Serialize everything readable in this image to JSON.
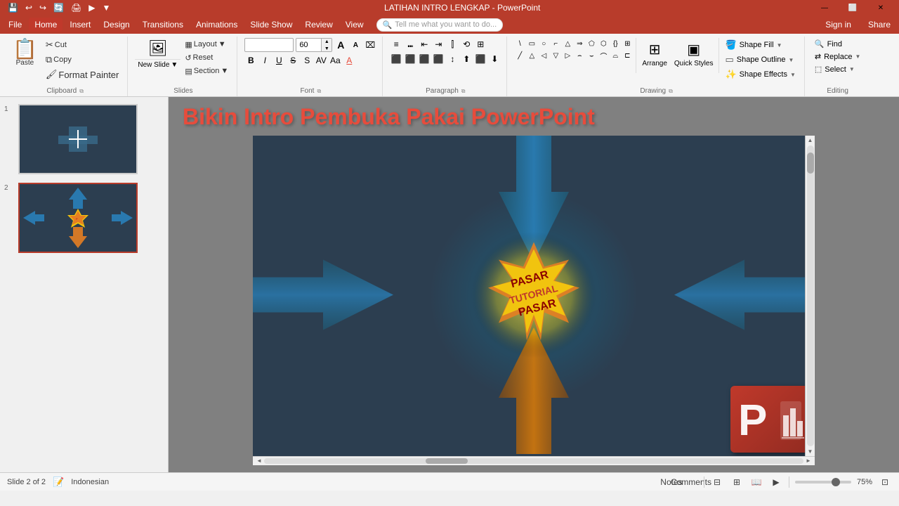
{
  "titlebar": {
    "title": "LATIHAN INTRO LENGKAP - PowerPoint",
    "save_icon": "💾",
    "undo_icon": "↩",
    "redo_icon": "↪",
    "autosave_icon": "🔄",
    "print_icon": "🖨",
    "present_icon": "▶",
    "customize_icon": "▼"
  },
  "menubar": {
    "items": [
      "File",
      "Home",
      "Insert",
      "Design",
      "Transitions",
      "Animations",
      "Slide Show",
      "Review",
      "View"
    ]
  },
  "ribbon": {
    "clipboard": {
      "label": "Clipboard",
      "paste_label": "Paste",
      "cut_label": "Cut",
      "copy_label": "Copy",
      "format_painter_label": "Format Painter"
    },
    "slides": {
      "label": "Slides",
      "new_slide_label": "New Slide",
      "layout_label": "Layout",
      "reset_label": "Reset",
      "section_label": "Section"
    },
    "font": {
      "label": "Font",
      "font_name": "",
      "font_size": "60",
      "bold": "B",
      "italic": "I",
      "underline": "U",
      "strikethrough": "S",
      "shadow": "S",
      "char_spacing": "AV",
      "change_case": "Aa",
      "font_color": "A"
    },
    "paragraph": {
      "label": "Paragraph"
    },
    "drawing": {
      "label": "Drawing",
      "arrange_label": "Arrange",
      "quick_styles_label": "Quick Styles",
      "shape_fill_label": "Shape Fill",
      "shape_outline_label": "Shape Outline",
      "shape_effects_label": "Shape Effects"
    },
    "editing": {
      "label": "Editing",
      "find_label": "Find",
      "replace_label": "Replace",
      "select_label": "Select"
    }
  },
  "slides": [
    {
      "num": "1",
      "active": false
    },
    {
      "num": "2",
      "active": true
    }
  ],
  "slide": {
    "title": "Bikin Intro Pembuka Pakai PowerPoint",
    "main_text_line1": "PASAR",
    "main_text_line2": "TUTORIAL",
    "main_text_line3": "PASAR"
  },
  "statusbar": {
    "slide_info": "Slide 2 of 2",
    "language": "Indonesian",
    "notes_label": "Notes",
    "comments_label": "Comments",
    "zoom_level": "75%"
  },
  "telltextbox": {
    "placeholder": "Tell me what you want to do..."
  },
  "auth": {
    "signin_label": "Sign in",
    "share_label": "Share"
  }
}
